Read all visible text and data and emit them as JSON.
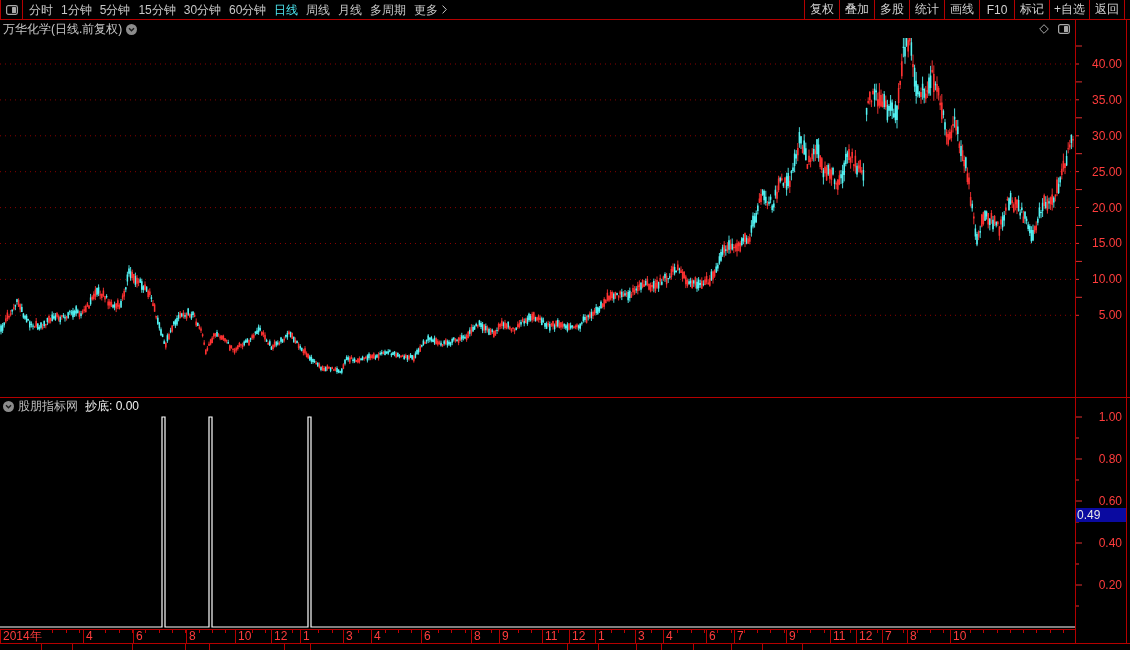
{
  "toolbar": {
    "periods": [
      {
        "label": "分时",
        "selected": false
      },
      {
        "label": "1分钟",
        "selected": false
      },
      {
        "label": "5分钟",
        "selected": false
      },
      {
        "label": "15分钟",
        "selected": false
      },
      {
        "label": "30分钟",
        "selected": false
      },
      {
        "label": "60分钟",
        "selected": false
      },
      {
        "label": "日线",
        "selected": true
      },
      {
        "label": "周线",
        "selected": false
      },
      {
        "label": "月线",
        "selected": false
      },
      {
        "label": "多周期",
        "selected": false
      }
    ],
    "more": "更多",
    "actions": [
      "复权",
      "叠加",
      "多股",
      "统计",
      "画线",
      "F10",
      "标记",
      "+自选",
      "返回"
    ]
  },
  "price_chart": {
    "title": "万华化学(日线.前复权)",
    "y_axis_labels": [
      "40.00",
      "35.00",
      "30.00",
      "25.00",
      "20.00",
      "15.00",
      "10.00",
      "5.00"
    ]
  },
  "indicator": {
    "name": "股朋指标网",
    "readout": "抄底: 0.00",
    "y_axis_labels": [
      "1.00",
      "0.80",
      "0.60",
      "0.40",
      "0.20"
    ],
    "cursor_value": "0.49"
  },
  "time_axis": {
    "labels": [
      "2014年",
      "4",
      "6",
      "8",
      "10",
      "12",
      "1",
      "3",
      "4",
      "6",
      "8",
      "9",
      "11",
      "12",
      "1",
      "3",
      "4",
      "6",
      "7",
      "9",
      "11",
      "12",
      "7",
      "8",
      "10"
    ]
  }
}
